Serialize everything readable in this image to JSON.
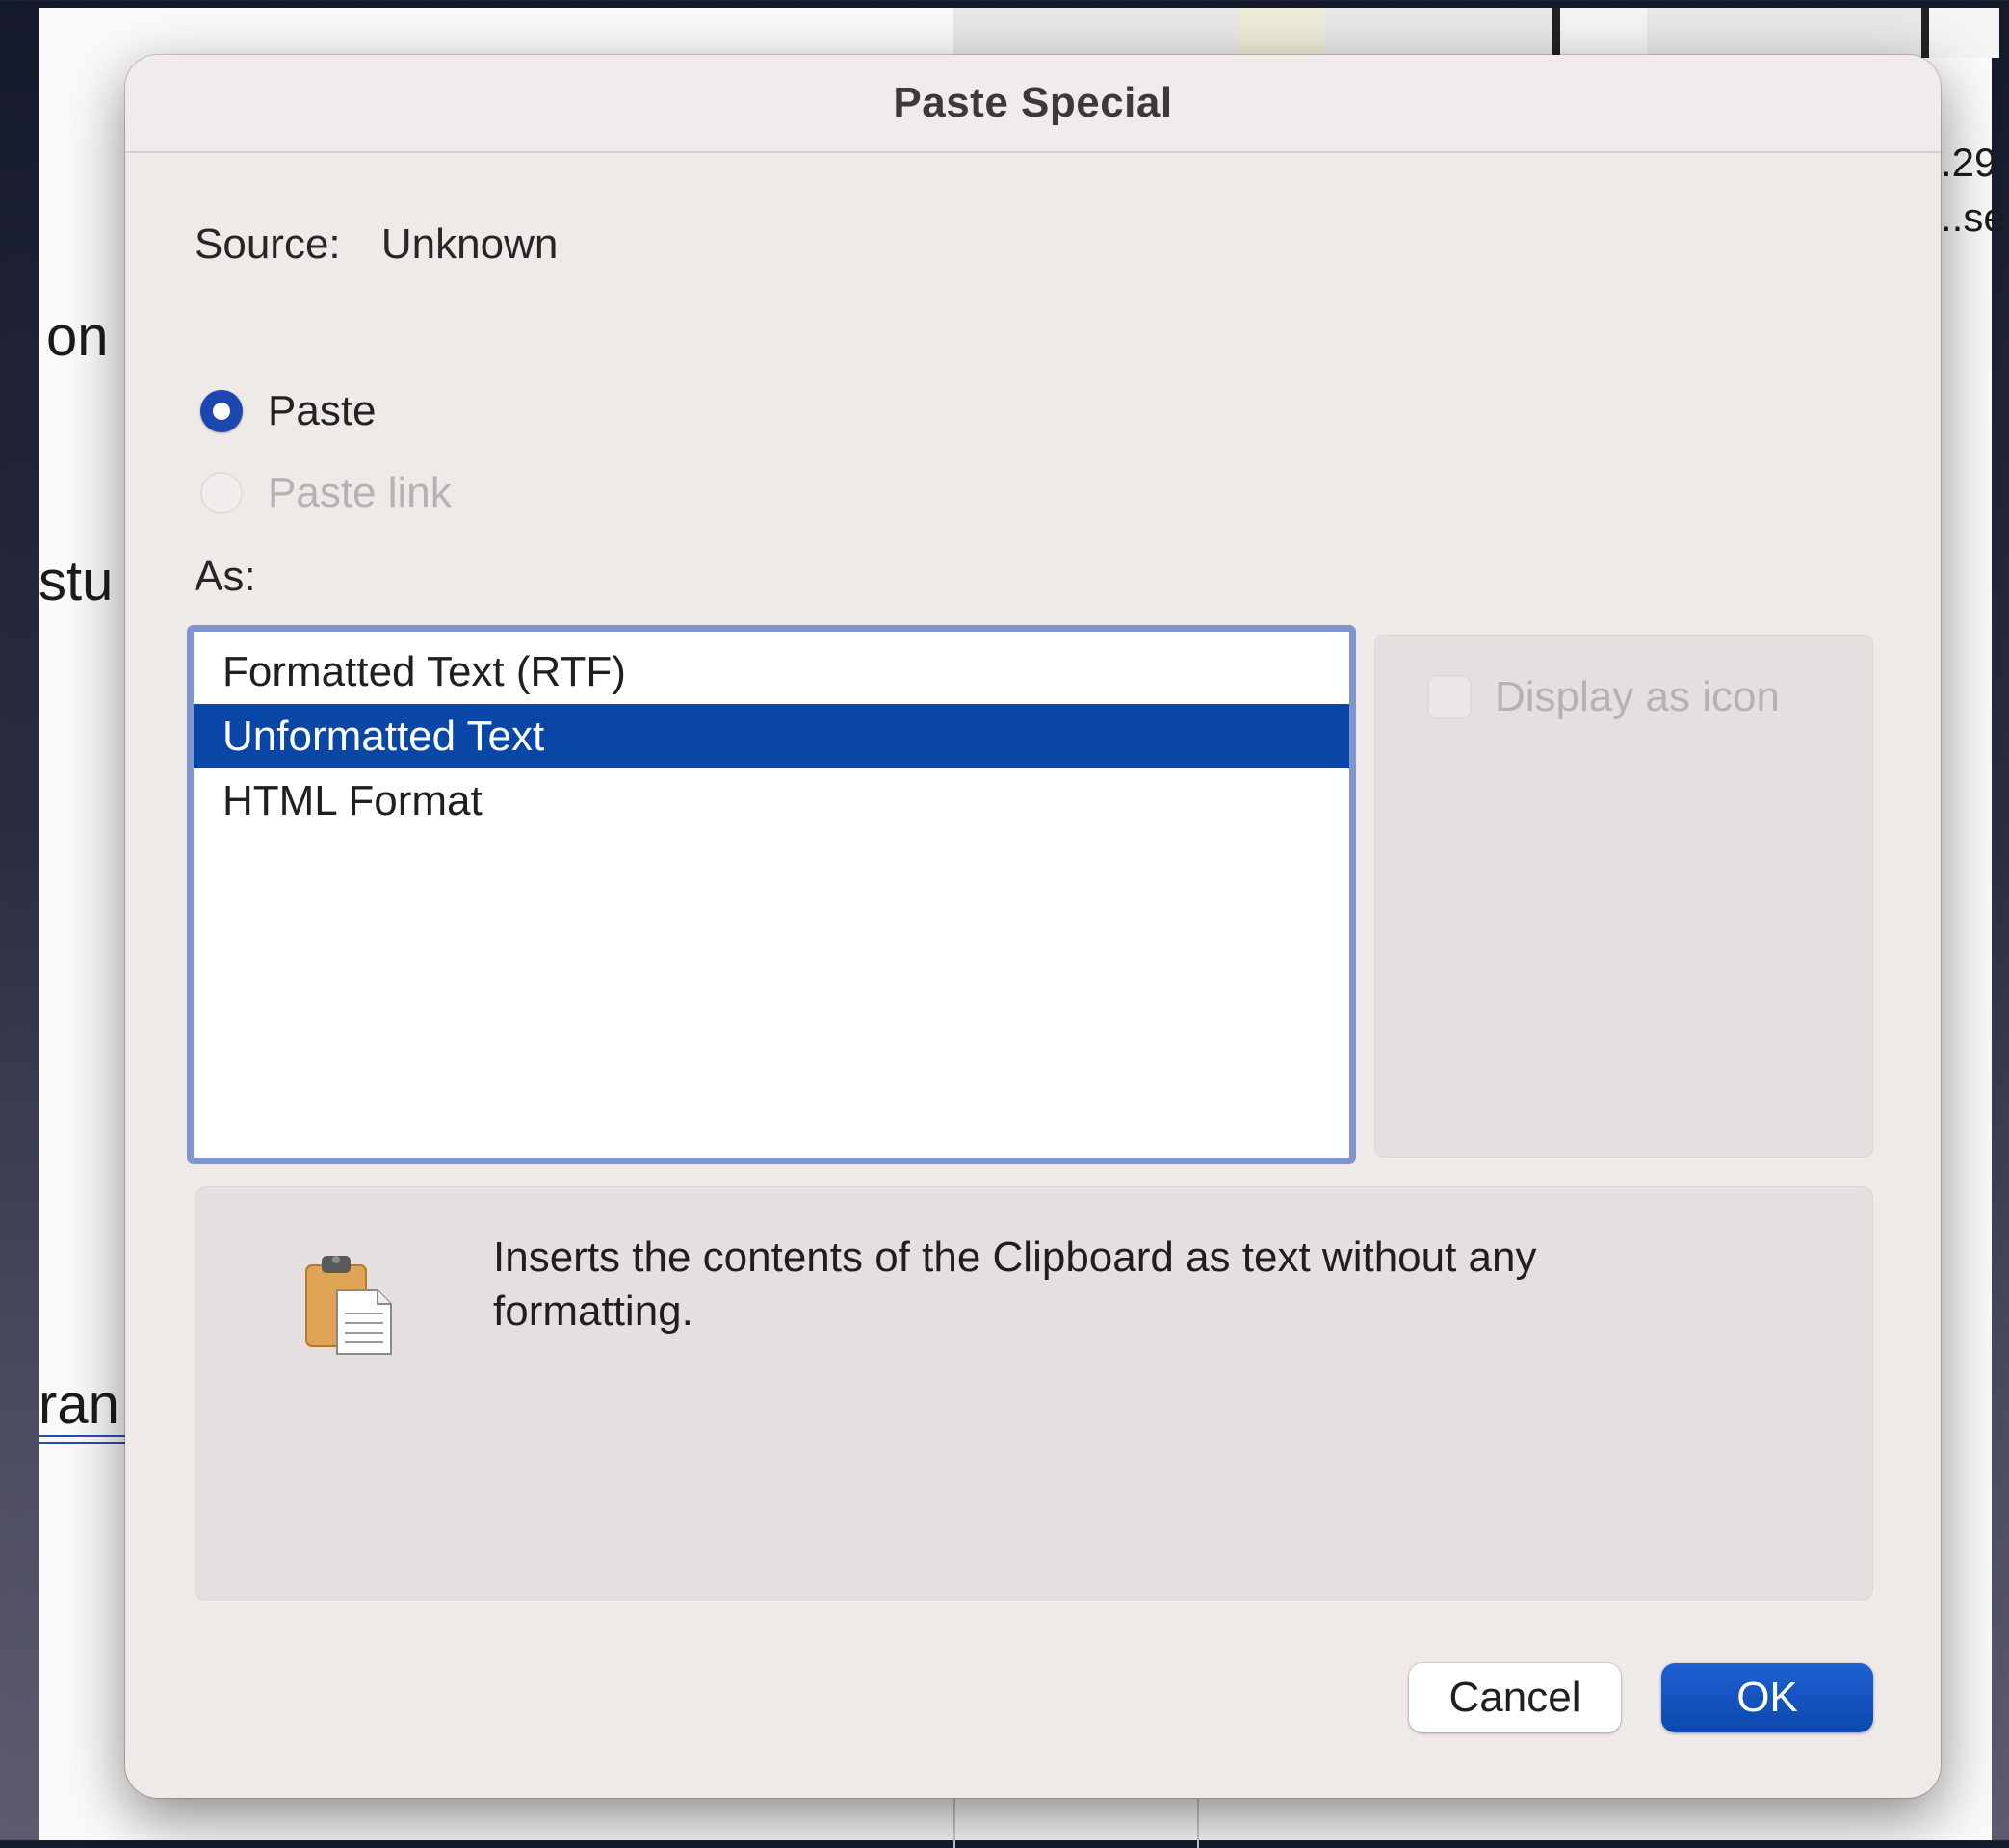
{
  "dialog": {
    "title": "Paste Special",
    "source_label": "Source:",
    "source_value": "Unknown",
    "paste_option": "Paste",
    "paste_link_option": "Paste link",
    "paste_selected": true,
    "paste_link_enabled": false,
    "as_label": "As:",
    "formats": [
      "Formatted Text (RTF)",
      "Unformatted Text",
      "HTML Format"
    ],
    "selected_format": "Unformatted Text",
    "display_as_icon_label": "Display as icon",
    "display_as_icon_checked": false,
    "display_as_icon_enabled": false,
    "result_icon": "clipboard-icon",
    "result_text": "Inserts the contents of the Clipboard as text without any formatting.",
    "cancel_label": "Cancel",
    "ok_label": "OK"
  },
  "background": {
    "fragments": [
      "on",
      "stu",
      "ran",
      ".29",
      "..se"
    ]
  },
  "colors": {
    "accent": "#0a46a6",
    "list_border": "#7f95cf",
    "dialog_bg": "#efe9e8"
  }
}
